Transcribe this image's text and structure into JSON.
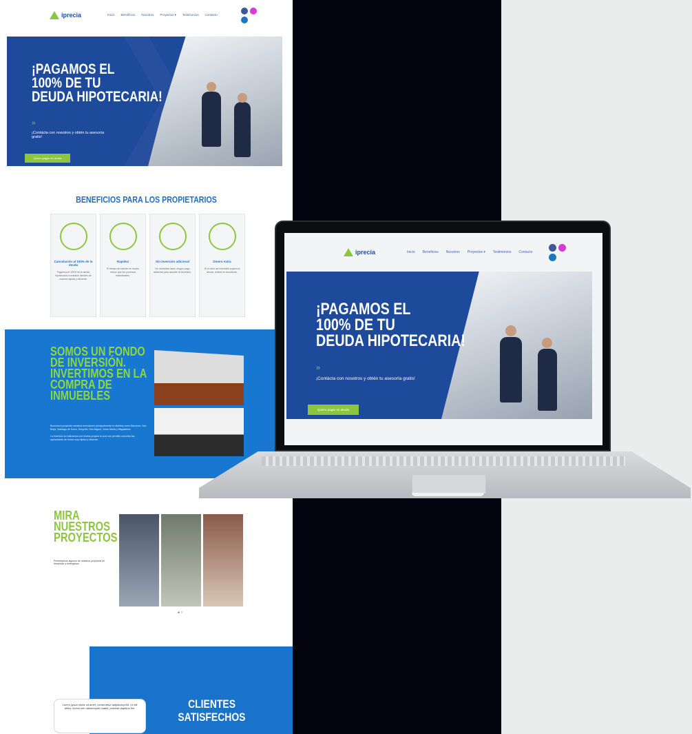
{
  "colors": {
    "brand_blue": "#1e4a9c",
    "accent_green": "#8cc63f",
    "light_blue": "#1878d1",
    "dark": "#02030f"
  },
  "logo": {
    "text": "iprecia",
    "icon": "triangle-logo-icon"
  },
  "nav": {
    "items": [
      "Inicio",
      "Beneficios",
      "Nosotros",
      "Proyectos ▾",
      "Testimonios",
      "Contacto"
    ]
  },
  "social": [
    "facebook-icon",
    "instagram-icon",
    "email-icon"
  ],
  "hero": {
    "title": "¡PAGAMOS EL\n100% DE TU\nDEUDA HIPOTECARIA!",
    "arrow": "»",
    "subtitle": "¡Contácta con nosotros y obtén tu asesoría gratis!",
    "button": "Quiero pagar mi deuda"
  },
  "benefits": {
    "title": "BENEFICIOS PARA LOS PROPIETARIOS",
    "cards": [
      {
        "title": "Cancelación al 100% de la deuda",
        "text": "Pagamos el 100% de la deuda hipotecaria a nuestros clientes de manera rápida y eficiente."
      },
      {
        "title": "Rapidez",
        "text": "El tiempo de trámite es mucho menor que los procesos tradicionales."
      },
      {
        "title": "Sin inversión adicional",
        "text": "No necesitas hacer ningún pago adicional para acceder al beneficio."
      },
      {
        "title": "Dinero extra",
        "text": "Si el valor del inmueble supera la deuda, recibes el excedente."
      }
    ]
  },
  "fund": {
    "title": "SOMOS UN FONDO\nDE INVERSIÓN.\nINVERTIMOS EN LA\nCOMPRA DE\nINMUEBLES",
    "text1": "Buscamos proyectar nuestras inversiones principalmente en distritos como Barranco, San Borja, Santiago de Surco, Surquillo, San Miguel, Jesús María y Magdalena.",
    "text2": "La inversión la realizamos con fondos propios lo cual nos permite concretar las operaciones de forma muy rápida y eficiente."
  },
  "projects": {
    "title": "MIRA\nNUESTROS\nPROYECTOS",
    "text": "Presentamos algunos de nuestros proyectos en desarrollo y entregados.",
    "dots": "● ○"
  },
  "clients": {
    "title": "CLIENTES\nSATISFECHOS",
    "testimonial": "Lorem ipsum dolor sit amet, consectetur adipiscing elit. Ut elit tellus, luctus nec ullamcorper mattis, pulvinar dapibus leo."
  }
}
